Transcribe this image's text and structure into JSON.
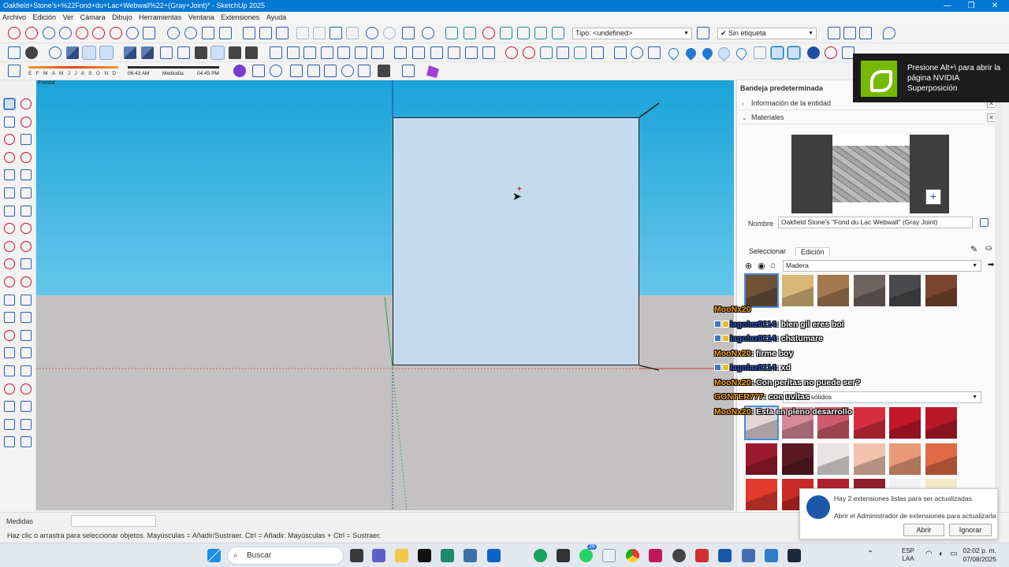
{
  "window": {
    "title": "Oakfield+Stone's+%22Fond+du+Lac+Webwall%22+(Gray+Joint)* - SketchUp 2025",
    "minimize": "—",
    "maximize": "❐",
    "close": "✕"
  },
  "menu": [
    "Archivo",
    "Edición",
    "Ver",
    "Cámara",
    "Dibujo",
    "Herramientas",
    "Ventana",
    "Extensiones",
    "Ayuda"
  ],
  "toolbar": {
    "type_combo": "Tipo: <undefined>",
    "tag_combo": "Sin etiqueta"
  },
  "shadows": {
    "months": "E F M A M J J A S O N D",
    "time_start": "06:43 AM",
    "time_mid": "Mediodía",
    "time_end": "04:45 PM"
  },
  "viewport": {
    "scene_label": "Frontal"
  },
  "chat": [
    {
      "user": "MooNx20",
      "text": "",
      "badge": false
    },
    {
      "user": "lagolaz0114",
      "text": ": bien gil eres boi",
      "badge": true
    },
    {
      "user": "lagolaz0114",
      "text": ": chatumare",
      "badge": true
    },
    {
      "user": "MooNx20",
      "text": ": firme boy",
      "badge": false
    },
    {
      "user": "lagolaz0114",
      "text": ": xd",
      "badge": true
    },
    {
      "user": "MooNx20",
      "text": ": Con peritas no puede ser?",
      "badge": false
    },
    {
      "user": "GONTER777",
      "text": ": con uvitas",
      "badge": false
    },
    {
      "user": "MooNx20",
      "text": ": Esta en pleno desarrollo",
      "badge": false
    }
  ],
  "tray": {
    "title": "Bandeja predeterminada",
    "entity_info": "Información de la entidad",
    "materials": "Materiales",
    "name_label": "Nombre",
    "name_value": "Oakfield Stone's \"Fond du Lac Webwall\" (Gray Joint)",
    "tab_select": "Seleccionar",
    "tab_edit": "Edición",
    "library_1": "Madera",
    "library_2_label": "Seleccionar",
    "library_2": "Colores sólidos",
    "wood_swatches": [
      "#6e5238",
      "#d9b878",
      "#a2784f",
      "#6e6360",
      "#4a4a4c",
      "#7a4530"
    ],
    "solid_swatches": [
      "#e3d4d8",
      "#d98a98",
      "#cf5a6b",
      "#d72e3f",
      "#c4172b",
      "#b8192a",
      "#9c1a2d",
      "#5a1a22",
      "#e8e4e4",
      "#f2c3ae",
      "#ea9a78",
      "#e06a45",
      "#e23a2c",
      "#c82a26",
      "#b02030",
      "#8e1e28",
      "#f1f1f1",
      "#f3e9c9"
    ]
  },
  "status": {
    "measure_label": "Medidas",
    "hint": "Haz clic o arrastra para seleccionar objetos. Mayúsculas = Añadir/Sustraer. Ctrl = Añadir. Mayúsculas + Ctrl = Sustraer."
  },
  "nvidia": {
    "line1": "Presione Alt+\\ para abrir la",
    "line2": "página NVIDIA",
    "line3": "Superposición"
  },
  "notification": {
    "line1": "Hay 2 extensiones listas para ser actualizadas.",
    "line2": "Abrir el Administrador de extensiones para actualizarla",
    "open": "Abrir",
    "ignore": "Ignorar"
  },
  "taskbar": {
    "search": "Buscar",
    "lang1": "ESP",
    "lang2": "LAA",
    "time": "02:02 p. m.",
    "date": "07/08/2025",
    "whatsapp_badge": "26"
  }
}
